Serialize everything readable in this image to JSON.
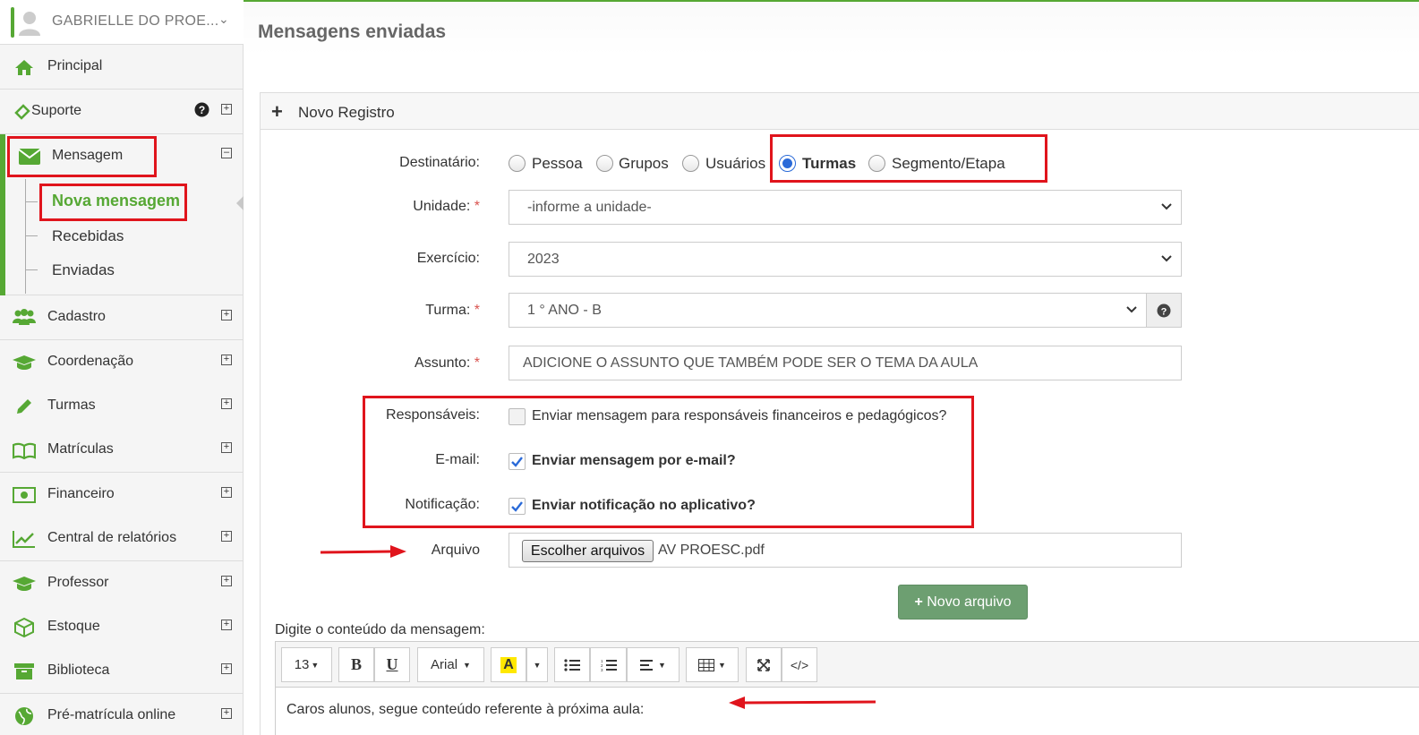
{
  "colors": {
    "accent": "#56a834",
    "highlight_border": "#e0141c",
    "radio_selected": "#2a6ad8",
    "button_green": "#6d9f71"
  },
  "sidebar": {
    "user_name": "GABRIELLE DO PROE...",
    "items": [
      {
        "label": "Principal",
        "icon": "home-icon"
      },
      {
        "label": "Suporte",
        "icon": "ticket-icon"
      },
      {
        "label": "Mensagem",
        "icon": "envelope-icon"
      },
      {
        "label": "Cadastro",
        "icon": "users-icon"
      },
      {
        "label": "Coordenação",
        "icon": "graduation-cap-icon"
      },
      {
        "label": "Turmas",
        "icon": "pencil-icon"
      },
      {
        "label": "Matrículas",
        "icon": "book-icon"
      },
      {
        "label": "Financeiro",
        "icon": "money-icon"
      },
      {
        "label": "Central de relatórios",
        "icon": "line-chart-icon"
      },
      {
        "label": "Professor",
        "icon": "graduation-cap-icon"
      },
      {
        "label": "Estoque",
        "icon": "box-icon"
      },
      {
        "label": "Biblioteca",
        "icon": "archive-icon"
      },
      {
        "label": "Pré-matrícula online",
        "icon": "globe-icon"
      }
    ],
    "mensagem_sub": [
      "Nova mensagem",
      "Recebidas",
      "Enviadas"
    ]
  },
  "page": {
    "title": "Mensagens enviadas"
  },
  "panel": {
    "title": "Novo Registro"
  },
  "form": {
    "destinatario_label": "Destinatário:",
    "destinatario_options": [
      "Pessoa",
      "Grupos",
      "Usuários",
      "Turmas",
      "Segmento/Etapa"
    ],
    "destinatario_selected": "Turmas",
    "unidade_label": "Unidade:",
    "unidade_value": "-informe a unidade-",
    "exercicio_label": "Exercício:",
    "exercicio_value": "2023",
    "turma_label": "Turma:",
    "turma_value": "1 ° ANO - B",
    "assunto_label": "Assunto:",
    "assunto_value": "ADICIONE O ASSUNTO QUE TAMBÉM PODE SER O TEMA DA AULA",
    "required_mark": "*",
    "responsaveis_label": "Responsáveis:",
    "responsaveis_text": "Enviar mensagem para responsáveis financeiros e pedagógicos?",
    "responsaveis_checked": false,
    "email_label": "E-mail:",
    "email_text": "Enviar mensagem por e-mail?",
    "email_checked": true,
    "notificacao_label": "Notificação:",
    "notificacao_text": "Enviar notificação no aplicativo?",
    "notificacao_checked": true,
    "arquivo_label": "Arquivo",
    "file_button": "Escolher arquivos",
    "file_name": "AV PROESC.pdf",
    "novo_arquivo_button": "Novo arquivo"
  },
  "editor": {
    "label": "Digite o conteúdo da mensagem:",
    "font_size": "13",
    "font_family": "Arial",
    "bold": "B",
    "underline": "U",
    "highlight": "A",
    "code_view": "</>",
    "content": "Caros alunos, segue conteúdo referente à próxima aula:"
  }
}
